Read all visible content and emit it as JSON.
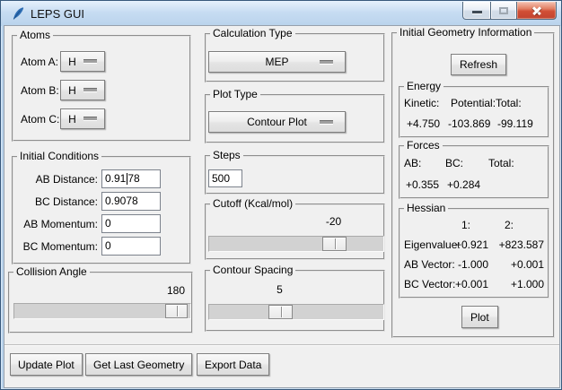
{
  "titlebar": {
    "title": "LEPS GUI"
  },
  "colors": {
    "titlebar_bg": "#c7dcf2",
    "close_button": "#d14f36",
    "client_bg": "#f0f0f0",
    "slider_trough": "#d2d2d2",
    "entry_bg": "#ffffff"
  },
  "icons": {
    "window": "feather-icon",
    "minimize": "minimize-icon",
    "maximize": "maximize-icon",
    "close": "close-icon",
    "optionmenu_indicator": "dash-icon"
  },
  "atoms": {
    "legend": "Atoms",
    "rows": [
      {
        "label": "Atom A:",
        "value": "H"
      },
      {
        "label": "Atom B:",
        "value": "H"
      },
      {
        "label": "Atom C:",
        "value": "H"
      }
    ]
  },
  "initial_conditions": {
    "legend": "Initial Conditions",
    "fields": [
      {
        "label": "AB Distance:",
        "value_pre": "0.91",
        "value_post": "78",
        "cursor": true
      },
      {
        "label": "BC Distance:",
        "value_pre": "0.9078",
        "value_post": "",
        "cursor": false
      },
      {
        "label": "AB Momentum:",
        "value_pre": "0",
        "value_post": "",
        "cursor": false
      },
      {
        "label": "BC Momentum:",
        "value_pre": "0",
        "value_post": "",
        "cursor": false
      }
    ]
  },
  "collision_angle": {
    "legend": "Collision Angle",
    "value": "180"
  },
  "calculation_type": {
    "legend": "Calculation Type",
    "value": "MEP"
  },
  "plot_type": {
    "legend": "Plot Type",
    "value": "Contour Plot"
  },
  "steps": {
    "legend": "Steps",
    "value": "500"
  },
  "cutoff": {
    "legend": "Cutoff (Kcal/mol)",
    "value": "-20"
  },
  "contour_spacing": {
    "legend": "Contour Spacing",
    "value": "5"
  },
  "geometry": {
    "legend": "Initial Geometry Information",
    "refresh_label": "Refresh",
    "energy": {
      "legend": "Energy",
      "columns": [
        {
          "header": "Kinetic:",
          "value": "+4.750"
        },
        {
          "header": "Potential:",
          "value": "-103.869"
        },
        {
          "header": "Total:",
          "value": "-99.119"
        }
      ]
    },
    "forces": {
      "legend": "Forces",
      "columns": [
        {
          "header": "AB:",
          "value": "+0.355"
        },
        {
          "header": "BC:",
          "value": "+0.284"
        },
        {
          "header": "Total:",
          "value": ""
        }
      ]
    },
    "hessian": {
      "legend": "Hessian",
      "col1_header": "1:",
      "col2_header": "2:",
      "rows": [
        {
          "label": "Eigenvalue:",
          "v1": "+0.921",
          "v2": "+823.587"
        },
        {
          "label": "AB Vector:",
          "v1": "-1.000",
          "v2": "+0.001"
        },
        {
          "label": "BC Vector:",
          "v1": "+0.001",
          "v2": "+1.000"
        }
      ]
    },
    "plot_label": "Plot"
  },
  "footer": {
    "buttons": [
      {
        "label": "Update Plot"
      },
      {
        "label": "Get Last Geometry"
      },
      {
        "label": "Export Data"
      }
    ]
  }
}
